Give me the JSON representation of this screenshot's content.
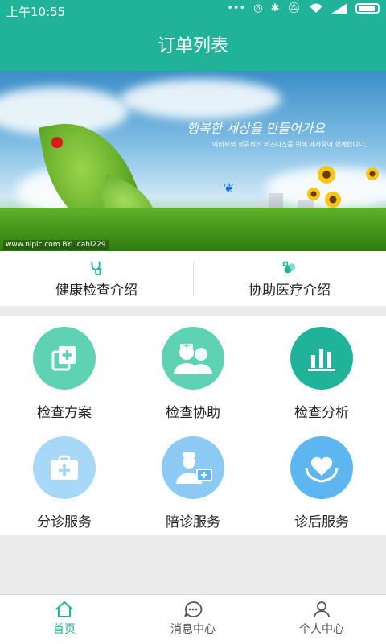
{
  "status_bar": {
    "time": "上午10:55",
    "network_label": "4G\n1X"
  },
  "header": {
    "title": "订单列表"
  },
  "banner": {
    "slogan": "행복한 세상을 만들어가요",
    "subtitle": "여러분의 성공적인 비즈니스를 위해 애사랑이 함께합니다.",
    "watermark": "www.nipic.com    BY: icahl229"
  },
  "intro": [
    {
      "label": "健康检查介绍",
      "icon": "stethoscope-icon"
    },
    {
      "label": "协助医疗介绍",
      "icon": "pill-icon"
    }
  ],
  "services": [
    {
      "label": "检查方案",
      "icon": "add-copy-icon",
      "color": "#5fd2b4"
    },
    {
      "label": "检查协助",
      "icon": "medical-staff-icon",
      "color": "#5fd2b4"
    },
    {
      "label": "检查分析",
      "icon": "bar-chart-icon",
      "color": "#21b39a"
    },
    {
      "label": "分诊服务",
      "icon": "first-aid-kit-icon",
      "color": "#a7d8f7"
    },
    {
      "label": "陪诊服务",
      "icon": "nurse-with-kit-icon",
      "color": "#8ccaf4"
    },
    {
      "label": "诊后服务",
      "icon": "heart-in-hands-icon",
      "color": "#5db6ef"
    }
  ],
  "tabbar": [
    {
      "label": "首页",
      "icon": "home-icon",
      "active": true
    },
    {
      "label": "消息中心",
      "icon": "message-icon",
      "active": false
    },
    {
      "label": "个人中心",
      "icon": "person-icon",
      "active": false
    }
  ],
  "colors": {
    "primary": "#21b39a",
    "tab_inactive": "#555555"
  }
}
